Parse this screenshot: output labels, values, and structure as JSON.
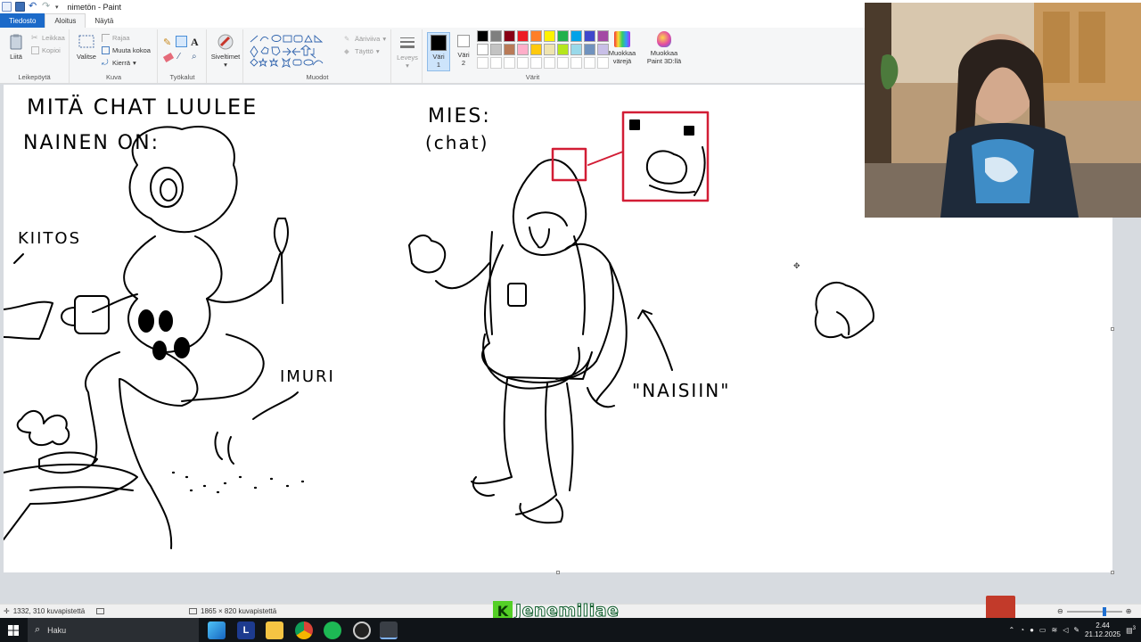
{
  "window": {
    "title": "nimetön - Paint"
  },
  "tabs": [
    {
      "label": "Tiedosto"
    },
    {
      "label": "Aloitus"
    },
    {
      "label": "Näytä"
    }
  ],
  "ribbon": {
    "clipboard": {
      "paste": "Liitä",
      "cut": "Leikkaa",
      "copy": "Kopioi",
      "group": "Leikepöytä"
    },
    "image": {
      "select": "Valitse",
      "crop": "Rajaa",
      "resize": "Muuta kokoa",
      "rotate": "Kierrä",
      "group": "Kuva"
    },
    "tools": {
      "group": "Työkalut"
    },
    "brushes": {
      "label": "Siveltimet"
    },
    "shapes": {
      "outline": "Ääriviiva",
      "fill": "Täyttö",
      "group": "Muodot"
    },
    "size": {
      "label": "Leveys"
    },
    "color1": {
      "label": "Väri",
      "num": "1"
    },
    "color2": {
      "label": "Väri",
      "num": "2"
    },
    "colors_group": "Värit",
    "edit_colors": {
      "line1": "Muokkaa",
      "line2": "värejä"
    },
    "paint3d": {
      "line1": "Muokkaa",
      "line2": "Paint 3D:llä"
    },
    "palette": [
      "#000000",
      "#7f7f7f",
      "#880015",
      "#ed1c24",
      "#ff7f27",
      "#fff200",
      "#22b14c",
      "#00a2e8",
      "#3f48cc",
      "#a349a4",
      "#ffffff",
      "#c3c3c3",
      "#b97a57",
      "#ffaec9",
      "#ffc90e",
      "#efe4b0",
      "#b5e61d",
      "#99d9ea",
      "#7092be",
      "#c8bfe7",
      "#ffffff",
      "#ffffff",
      "#ffffff",
      "#ffffff",
      "#ffffff",
      "#ffffff",
      "#ffffff",
      "#ffffff",
      "#ffffff",
      "#ffffff"
    ]
  },
  "drawing": {
    "left_title_1": "MITÄ CHAT LUULEE",
    "left_title_2": "NAINEN ON:",
    "kiitos": "KIITOS",
    "imuri": "IMURI",
    "mies": "MIES:",
    "chat": "(chat)",
    "naisiin": "\"NAISIIN\""
  },
  "status": {
    "cursor_pos": "1332, 310 kuvapistettä",
    "image_size": "1865 × 820 kuvapistettä"
  },
  "overlay": {
    "streamer_name": "Jenemiliae",
    "logo_letter": "K"
  },
  "taskbar": {
    "search": "Haku",
    "time": "2.44",
    "date": "21.12.2025",
    "notif_count": "3",
    "label_l": "L"
  }
}
